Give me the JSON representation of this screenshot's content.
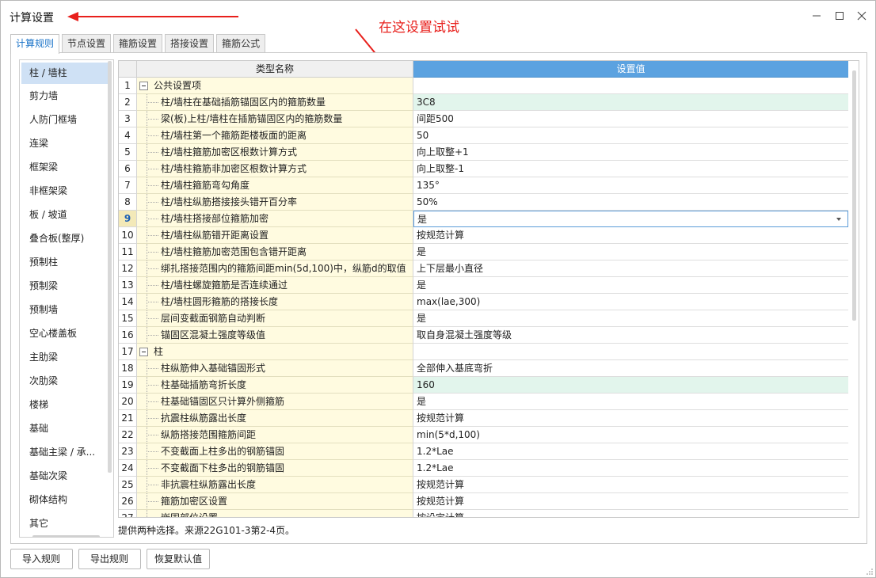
{
  "window": {
    "title": "计算设置",
    "annotation": "在这设置试试"
  },
  "tabs": [
    "计算规则",
    "节点设置",
    "箍筋设置",
    "搭接设置",
    "箍筋公式"
  ],
  "sidebar": {
    "items": [
      "柱 / 墙柱",
      "剪力墙",
      "人防门框墙",
      "连梁",
      "框架梁",
      "非框架梁",
      "板 / 坡道",
      "叠合板(整厚)",
      "预制柱",
      "预制梁",
      "预制墙",
      "空心楼盖板",
      "主肋梁",
      "次肋梁",
      "楼梯",
      "基础",
      "基础主梁 / 承...",
      "基础次梁",
      "砌体结构",
      "其它"
    ]
  },
  "grid": {
    "col_name": "类型名称",
    "col_value": "设置值",
    "rows": [
      {
        "num": "1",
        "name": "公共设置项",
        "value": "",
        "group": true
      },
      {
        "num": "2",
        "name": "柱/墙柱在基础插筋锚固区内的箍筋数量",
        "value": "3C8",
        "highlight": true
      },
      {
        "num": "3",
        "name": "梁(板)上柱/墙柱在插筋锚固区内的箍筋数量",
        "value": "间距500"
      },
      {
        "num": "4",
        "name": "柱/墙柱第一个箍筋距楼板面的距离",
        "value": "50"
      },
      {
        "num": "5",
        "name": "柱/墙柱箍筋加密区根数计算方式",
        "value": "向上取整+1"
      },
      {
        "num": "6",
        "name": "柱/墙柱箍筋非加密区根数计算方式",
        "value": "向上取整-1"
      },
      {
        "num": "7",
        "name": "柱/墙柱箍筋弯勾角度",
        "value": "135°"
      },
      {
        "num": "8",
        "name": "柱/墙柱纵筋搭接接头错开百分率",
        "value": "50%"
      },
      {
        "num": "9",
        "name": "柱/墙柱搭接部位箍筋加密",
        "value": "是",
        "selected": true
      },
      {
        "num": "10",
        "name": "柱/墙柱纵筋错开距离设置",
        "value": "按规范计算"
      },
      {
        "num": "11",
        "name": "柱/墙柱箍筋加密范围包含错开距离",
        "value": "是"
      },
      {
        "num": "12",
        "name": "绑扎搭接范围内的箍筋间距min(5d,100)中，纵筋d的取值",
        "value": "上下层最小直径"
      },
      {
        "num": "13",
        "name": "柱/墙柱螺旋箍筋是否连续通过",
        "value": "是"
      },
      {
        "num": "14",
        "name": "柱/墙柱圆形箍筋的搭接长度",
        "value": "max(lae,300)"
      },
      {
        "num": "15",
        "name": "层间变截面钢筋自动判断",
        "value": "是"
      },
      {
        "num": "16",
        "name": "锚固区混凝土强度等级值",
        "value": "取自身混凝土强度等级"
      },
      {
        "num": "17",
        "name": "柱",
        "value": "",
        "group": true
      },
      {
        "num": "18",
        "name": "柱纵筋伸入基础锚固形式",
        "value": "全部伸入基底弯折"
      },
      {
        "num": "19",
        "name": "柱基础插筋弯折长度",
        "value": "160",
        "highlight": true
      },
      {
        "num": "20",
        "name": "柱基础锚固区只计算外侧箍筋",
        "value": "是"
      },
      {
        "num": "21",
        "name": "抗震柱纵筋露出长度",
        "value": "按规范计算"
      },
      {
        "num": "22",
        "name": "纵筋搭接范围箍筋间距",
        "value": "min(5*d,100)"
      },
      {
        "num": "23",
        "name": "不变截面上柱多出的钢筋锚固",
        "value": "1.2*Lae"
      },
      {
        "num": "24",
        "name": "不变截面下柱多出的钢筋锚固",
        "value": "1.2*Lae"
      },
      {
        "num": "25",
        "name": "非抗震柱纵筋露出长度",
        "value": "按规范计算"
      },
      {
        "num": "26",
        "name": "箍筋加密区设置",
        "value": "按规范计算"
      },
      {
        "num": "27",
        "name": "嵌固部位设置",
        "value": "按设定计算"
      }
    ]
  },
  "hint": "提供两种选择。来源22G101-3第2-4页。",
  "buttons": {
    "import": "导入规则",
    "export": "导出规则",
    "restore": "恢复默认值"
  },
  "colors": {
    "accent": "#5ba2e0",
    "annotation": "#e8201c",
    "name_cell_bg": "#fffbe0",
    "highlight_bg": "#e2f5ec"
  }
}
